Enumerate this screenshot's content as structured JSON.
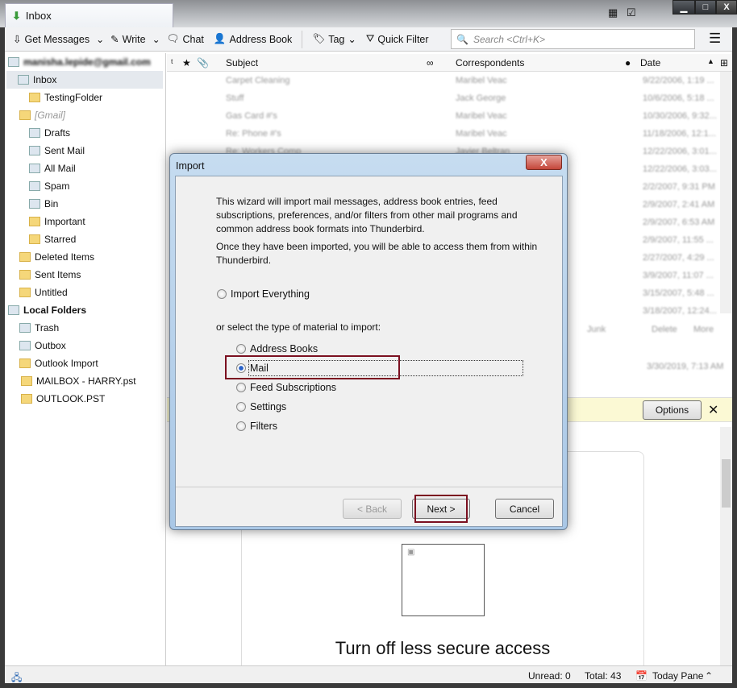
{
  "window": {
    "tab_title": "Inbox",
    "minimize": "▁",
    "maximize": "□",
    "close": "X"
  },
  "toolbar": {
    "get_messages": "Get Messages",
    "write": "Write",
    "chat": "Chat",
    "address_book": "Address Book",
    "tag": "Tag",
    "quick_filter": "Quick Filter",
    "search_placeholder": "Search <Ctrl+K>"
  },
  "folders": [
    {
      "label": "manisha.lepide@gmail.com",
      "level": 0,
      "icon": "account-icon"
    },
    {
      "label": "Inbox",
      "level": 1,
      "icon": "inbox-icon"
    },
    {
      "label": "TestingFolder",
      "level": 2,
      "icon": "folder-icon"
    },
    {
      "label": "[Gmail]",
      "level": 1,
      "icon": "folder-icon"
    },
    {
      "label": "Drafts",
      "level": 2,
      "icon": "drafts-icon"
    },
    {
      "label": "Sent Mail",
      "level": 2,
      "icon": "sent-icon"
    },
    {
      "label": "All Mail",
      "level": 2,
      "icon": "archive-icon"
    },
    {
      "label": "Spam",
      "level": 2,
      "icon": "spam-icon"
    },
    {
      "label": "Bin",
      "level": 2,
      "icon": "trash-icon"
    },
    {
      "label": "Important",
      "level": 2,
      "icon": "folder-icon"
    },
    {
      "label": "Starred",
      "level": 2,
      "icon": "folder-icon"
    },
    {
      "label": "Deleted Items",
      "level": 1,
      "icon": "folder-icon"
    },
    {
      "label": "Sent Items",
      "level": 1,
      "icon": "folder-icon"
    },
    {
      "label": "Untitled",
      "level": 1,
      "icon": "folder-icon"
    },
    {
      "label": "Local Folders",
      "level": 0,
      "icon": "computer-icon"
    },
    {
      "label": "Trash",
      "level": 1,
      "icon": "trash-icon"
    },
    {
      "label": "Outbox",
      "level": 1,
      "icon": "outbox-icon"
    },
    {
      "label": "Outlook Import",
      "level": 1,
      "icon": "folder-icon"
    },
    {
      "label": "MAILBOX - HARRY.pst",
      "level": 2,
      "icon": "folder-icon"
    },
    {
      "label": "OUTLOOK.PST",
      "level": 2,
      "icon": "folder-icon"
    }
  ],
  "columns": {
    "subject": "Subject",
    "correspondents": "Correspondents",
    "date": "Date"
  },
  "messages": [
    {
      "subject": "Carpet Cleaning",
      "from": "Maribel Veac",
      "date": "9/22/2006, 1:19 ..."
    },
    {
      "subject": "Stuff",
      "from": "Jack George",
      "date": "10/6/2006, 5:18 ..."
    },
    {
      "subject": "Gas Card #'s",
      "from": "Maribel Veac",
      "date": "10/30/2006, 9:32..."
    },
    {
      "subject": "Re: Phone #'s",
      "from": "Maribel Veac",
      "date": "11/18/2006, 12:1..."
    },
    {
      "subject": "Re: Workers Comp",
      "from": "Javier Beltran",
      "date": "12/22/2006, 3:01..."
    },
    {
      "subject": "Re: Workers Comp",
      "from": "Javier Beltran",
      "date": "12/22/2006, 3:03..."
    },
    {
      "subject": "",
      "from": "",
      "date": "2/2/2007, 9:31 PM"
    },
    {
      "subject": "",
      "from": "",
      "date": "2/9/2007, 2:41 AM"
    },
    {
      "subject": "",
      "from": "",
      "date": "2/9/2007, 6:53 AM"
    },
    {
      "subject": "",
      "from": "",
      "date": "2/9/2007, 11:55 ..."
    },
    {
      "subject": "",
      "from": "",
      "date": "2/27/2007, 4:29 ..."
    },
    {
      "subject": "",
      "from": "",
      "date": "3/9/2007, 11:07 ..."
    },
    {
      "subject": "",
      "from": "",
      "date": "3/15/2007, 5:48 ..."
    },
    {
      "subject": "",
      "from": "",
      "date": "3/18/2007, 12:24..."
    }
  ],
  "message_pane": {
    "junk": "Junk",
    "delete": "Delete",
    "more": "More",
    "date": "3/30/2019, 7:13 AM",
    "options": "Options",
    "close": "✕",
    "heading": "Turn off less secure access"
  },
  "dialog": {
    "title": "Import",
    "close": "X",
    "intro": "This wizard will import mail messages, address book entries, feed subscriptions, preferences, and/or filters from other mail programs and common address book formats into Thunderbird.",
    "intro2": "Once they have been imported, you will be able to access them from within Thunderbird.",
    "import_everything": "Import Everything",
    "select_label": "or select the type of material to import:",
    "options": [
      {
        "label": "Address Books",
        "selected": false
      },
      {
        "label": "Mail",
        "selected": true
      },
      {
        "label": "Feed Subscriptions",
        "selected": false
      },
      {
        "label": "Settings",
        "selected": false
      },
      {
        "label": "Filters",
        "selected": false
      }
    ],
    "back": "< Back",
    "next": "Next >",
    "cancel": "Cancel",
    "highlight_color": "#7b1020"
  },
  "status": {
    "unread": "Unread: 0",
    "total": "Total: 43",
    "today_pane": "Today Pane"
  }
}
